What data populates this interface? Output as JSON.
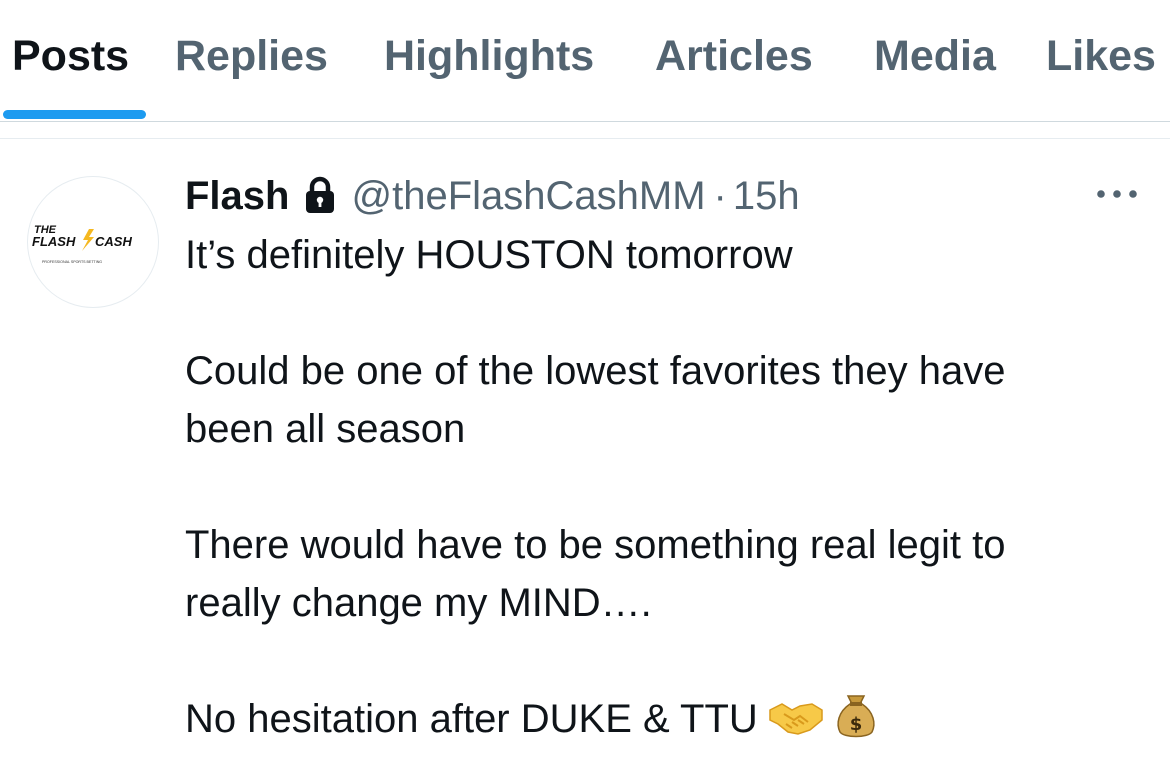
{
  "tabs": [
    {
      "label": "Posts",
      "active": true
    },
    {
      "label": "Replies",
      "active": false
    },
    {
      "label": "Highlights",
      "active": false
    },
    {
      "label": "Articles",
      "active": false
    },
    {
      "label": "Media",
      "active": false
    },
    {
      "label": "Likes",
      "active": false
    }
  ],
  "post": {
    "author_name": "Flash",
    "protected": true,
    "handle": "@theFlashCashMM",
    "separator": "·",
    "time": "15h",
    "avatar": {
      "line1": "THE",
      "line2": "FLASH",
      "line3": "CASH",
      "tagline": "PROFESSIONAL SPORTS BETTING"
    },
    "text_lines": [
      "It’s definitely HOUSTON tomorrow",
      "Could be one of the lowest favorites they have",
      "been all season",
      "There would have to be something real legit to",
      "really change my MIND….",
      "No hesitation after DUKE & TTU"
    ],
    "emojis": [
      "handshake-emoji",
      "money-bag-emoji"
    ],
    "icons": [
      "lock-icon",
      "more-icon"
    ]
  },
  "colors": {
    "accent": "#1d9bf0",
    "text_primary": "#0f1419",
    "text_secondary": "#536471",
    "divider": "#cfd9de"
  }
}
